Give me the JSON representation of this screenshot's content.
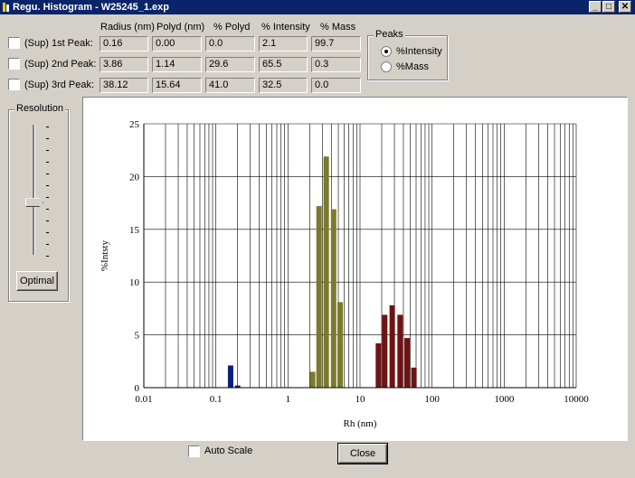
{
  "window": {
    "title": "Regu. Histogram - W25245_1.exp",
    "minimize_glyph": "_",
    "maximize_glyph": "□",
    "close_glyph": "✕"
  },
  "table": {
    "headers": [
      "Radius (nm)",
      "Polyd (nm)",
      "% Polyd",
      "% Intensity",
      "% Mass"
    ],
    "rows": [
      {
        "label": "(Sup) 1st Peak:",
        "checked": false,
        "values": [
          "0.16",
          "0.00",
          "0.0",
          "2.1",
          "99.7"
        ]
      },
      {
        "label": "(Sup) 2nd Peak:",
        "checked": false,
        "values": [
          "3.86",
          "1.14",
          "29.6",
          "65.5",
          "0.3"
        ]
      },
      {
        "label": "(Sup) 3rd Peak:",
        "checked": false,
        "values": [
          "38.12",
          "15.64",
          "41.0",
          "32.5",
          "0.0"
        ]
      }
    ]
  },
  "peaks": {
    "legend": "Peaks",
    "options": [
      "%Intensity",
      "%Mass"
    ],
    "selected": "%Intensity"
  },
  "resolution": {
    "legend": "Resolution",
    "slider_level": 0.6,
    "optimal_label": "Optimal"
  },
  "auto_scale": {
    "label": "Auto Scale",
    "checked": false
  },
  "close_label": "Close",
  "icons": [
    "app-icon",
    "minimize-icon",
    "maximize-icon",
    "close-icon"
  ],
  "chart_data": {
    "type": "bar",
    "x_scale": "log",
    "xlim": [
      0.01,
      10000
    ],
    "ylim": [
      0,
      25
    ],
    "xlabel": "Rh (nm)",
    "ylabel": "%Intsty",
    "x_tick_labels": [
      "0.01",
      "0.1",
      "1",
      "10",
      "100",
      "1000",
      "10000"
    ],
    "y_tick_labels": [
      "0",
      "5",
      "10",
      "15",
      "20",
      "25"
    ],
    "grid": true,
    "series": [
      {
        "color": "#0a1f7a",
        "bars": [
          {
            "x": 0.16,
            "y": 2.1
          },
          {
            "x": 0.2,
            "y": 0.2
          }
        ]
      },
      {
        "color": "#7a7a2a",
        "bars": [
          {
            "x": 2.2,
            "y": 1.5
          },
          {
            "x": 2.7,
            "y": 17.2
          },
          {
            "x": 3.4,
            "y": 21.9
          },
          {
            "x": 4.3,
            "y": 16.9
          },
          {
            "x": 5.3,
            "y": 8.1
          }
        ]
      },
      {
        "color": "#6e1313",
        "bars": [
          {
            "x": 18,
            "y": 4.2
          },
          {
            "x": 22,
            "y": 6.9
          },
          {
            "x": 28,
            "y": 7.8
          },
          {
            "x": 36,
            "y": 6.9
          },
          {
            "x": 45,
            "y": 4.7
          },
          {
            "x": 56,
            "y": 1.9
          }
        ]
      }
    ]
  }
}
